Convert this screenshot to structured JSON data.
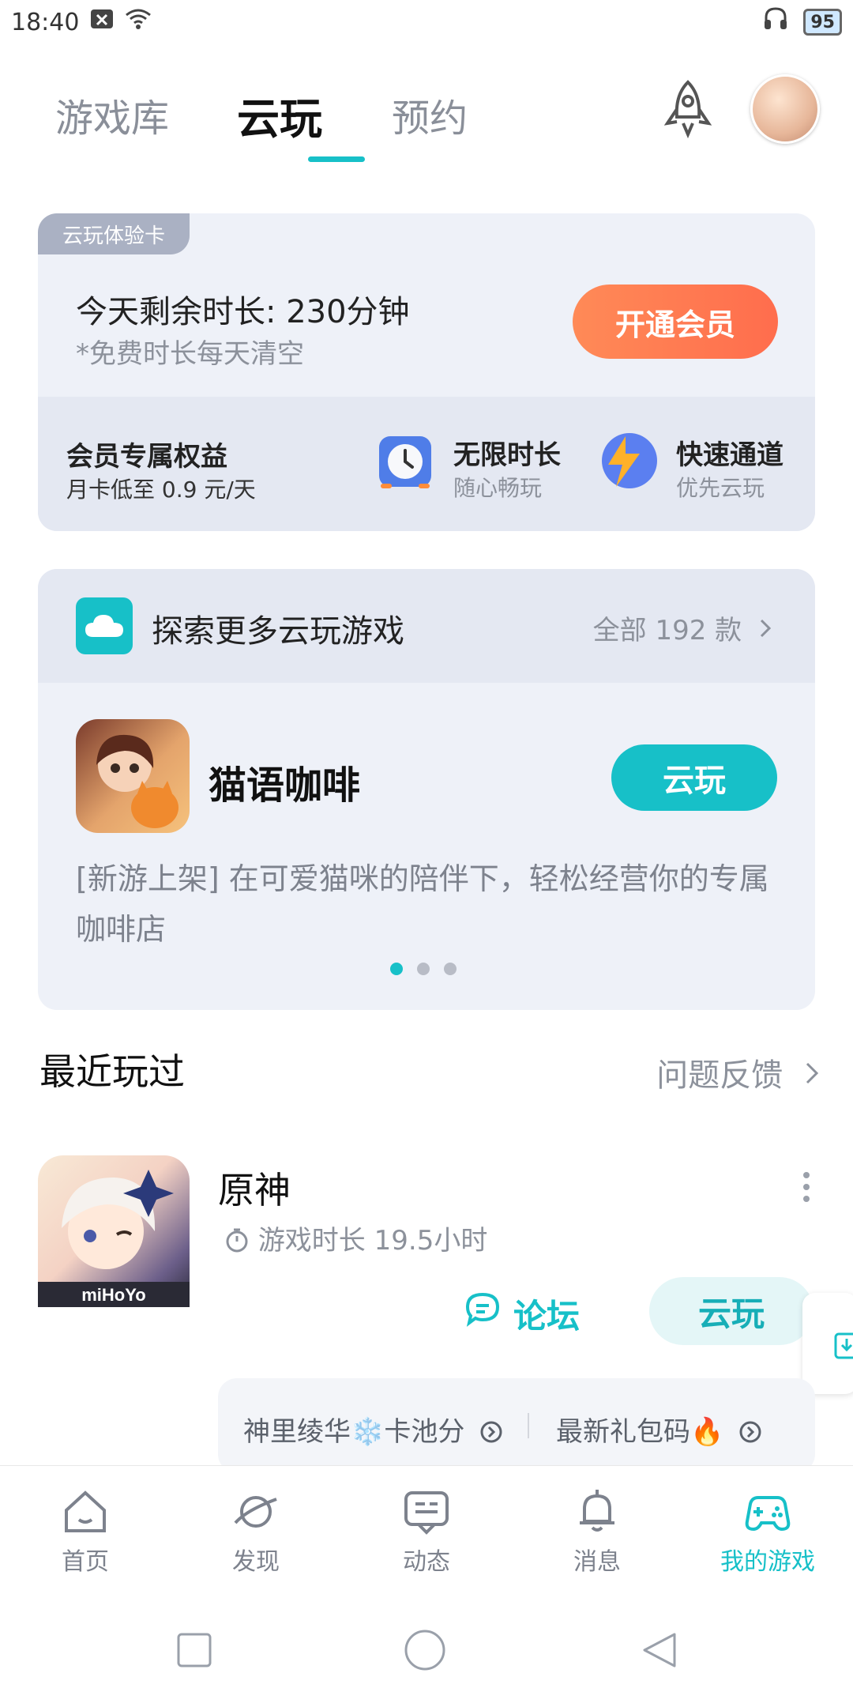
{
  "status": {
    "time": "18:40",
    "battery": "95"
  },
  "top_tabs": {
    "items": [
      {
        "label": "游戏库"
      },
      {
        "label": "云玩"
      },
      {
        "label": "预约"
      }
    ],
    "active_index": 1
  },
  "membership": {
    "badge": "云玩体验卡",
    "remaining": "今天剩余时长: 230分钟",
    "note": "*免费时长每天清空",
    "open_button": "开通会员",
    "benefits_title": "会员专属权益",
    "benefits_sub": "月卡低至 0.9 元/天",
    "benefits": [
      {
        "label": "无限时长",
        "desc": "随心畅玩",
        "icon": "alarm-clock-icon"
      },
      {
        "label": "快速通道",
        "desc": "优先云玩",
        "icon": "lightning-icon"
      }
    ]
  },
  "explore": {
    "title": "探索更多云玩游戏",
    "all_text": "全部 192 款",
    "game": {
      "name": "猫语咖啡",
      "button": "云玩",
      "desc": "[新游上架] 在可爱猫咪的陪伴下，轻松经营你的专属咖啡店"
    },
    "carousel_pages": 3,
    "carousel_active": 0
  },
  "recent": {
    "title": "最近玩过",
    "feedback": "问题反馈",
    "game": {
      "name": "原神",
      "time": "游戏时长 19.5小时",
      "forum": "论坛",
      "button": "云玩",
      "icon_brand": "miHoYo"
    },
    "info": [
      {
        "text": "神里绫华❄️卡池分"
      },
      {
        "text": "最新礼包码🔥"
      }
    ]
  },
  "bottom_nav": {
    "items": [
      {
        "label": "首页"
      },
      {
        "label": "发现"
      },
      {
        "label": "动态"
      },
      {
        "label": "消息"
      },
      {
        "label": "我的游戏"
      }
    ],
    "active_index": 4
  },
  "colors": {
    "accent": "#17c0c8",
    "orange": "#ff7a52"
  }
}
